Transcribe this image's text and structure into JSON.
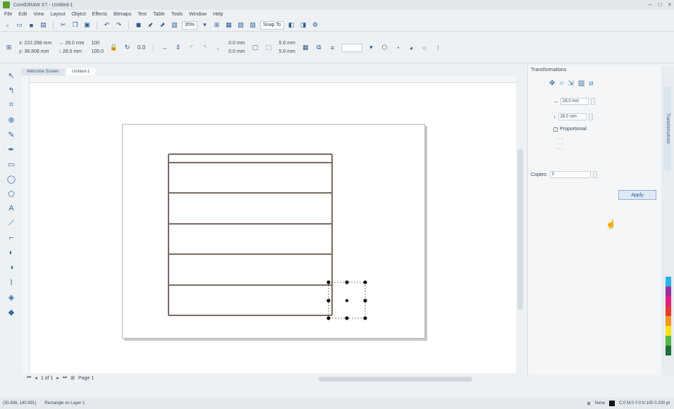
{
  "window": {
    "title": "CorelDRAW X7 - Untitled-1",
    "controls": [
      "–",
      "□",
      "×"
    ]
  },
  "menu": [
    "File",
    "Edit",
    "View",
    "Layout",
    "Object",
    "Effects",
    "Bitmaps",
    "Text",
    "Table",
    "Tools",
    "Window",
    "Help"
  ],
  "toolbar": {
    "zoom": "35%",
    "snap": "Snap To"
  },
  "propbar": {
    "x": "x: 222.288 mm",
    "y": "y: 36.808 mm",
    "w": "↔ 28.0 mm",
    "h": "↕ 28.0 mm",
    "sx": "100",
    "sy": "100.0",
    "angle": "0.0",
    "outline1": "0.0 mm",
    "outline2": "0.0 mm",
    "offset1": "5.0 mm",
    "offset2": "5.0 mm"
  },
  "tabs": {
    "welcome": "Welcome Screen",
    "doc": "Untitled-1"
  },
  "docker": {
    "title": "Transformations",
    "size_w": "28.0 mm",
    "size_h": "28.0 mm",
    "proportional_label": "Proportional",
    "copies_label": "Copies:",
    "copies_value": "0",
    "apply_label": "Apply"
  },
  "docker_strip": {
    "tab_label": "Transformations"
  },
  "pagenav": {
    "counter": "1 of 1",
    "page_label": "Page 1"
  },
  "status": {
    "coords": "(30.836, 140.991)",
    "object": "Rectangle on Layer 1",
    "fill": "None",
    "color_info": "C:0 M:0 Y:0 K:100  0.200 pt"
  },
  "icons": {
    "tools": [
      "pointer-icon",
      "shape-icon",
      "crop-icon",
      "zoom-icon",
      "freehand-icon",
      "artistic-media-icon",
      "rectangle-icon",
      "ellipse-icon",
      "polygon-icon",
      "text-icon",
      "parallel-dimension-icon",
      "connector-icon",
      "blend-icon",
      "transparency-icon",
      "eyedropper-icon",
      "interactive-fill-icon",
      "smart-fill-icon"
    ]
  },
  "colors": {
    "accent": "#2b6aa5",
    "stroke": "#7a6a64",
    "page_bg": "#ffffff"
  }
}
